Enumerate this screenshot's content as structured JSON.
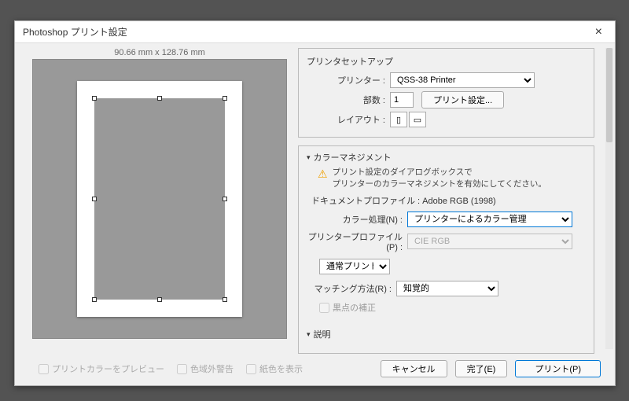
{
  "dialog": {
    "title": "Photoshop プリント設定"
  },
  "preview": {
    "dimensions": "90.66 mm x 128.76 mm"
  },
  "printerSetup": {
    "heading": "プリンタセットアップ",
    "printerLabel": "プリンター :",
    "printerValue": "QSS-38 Printer",
    "copiesLabel": "部数 :",
    "copiesValue": "1",
    "printSettingsBtn": "プリント設定...",
    "layoutLabel": "レイアウト :"
  },
  "colorMgmt": {
    "heading": "カラーマネジメント",
    "warning1": "プリント設定のダイアログボックスで",
    "warning2": "プリンターのカラーマネジメントを有効にしてください。",
    "docProfile": "ドキュメントプロファイル : Adobe RGB (1998)",
    "handlingLabel": "カラー処理(N) :",
    "handlingValue": "プリンターによるカラー管理",
    "printerProfileLabel": "プリンタープロファイル(P) :",
    "printerProfileValue": "CIE RGB",
    "normalPrint": "通常プリント",
    "renderLabel": "マッチング方法(R) :",
    "renderValue": "知覚的",
    "blackPoint": "黒点の補正"
  },
  "desc": {
    "heading": "説明"
  },
  "footer": {
    "previewColors": "プリントカラーをプレビュー",
    "gamutWarn": "色域外警告",
    "showPaper": "紙色を表示",
    "cancel": "キャンセル",
    "done": "完了(E)",
    "print": "プリント(P)"
  }
}
